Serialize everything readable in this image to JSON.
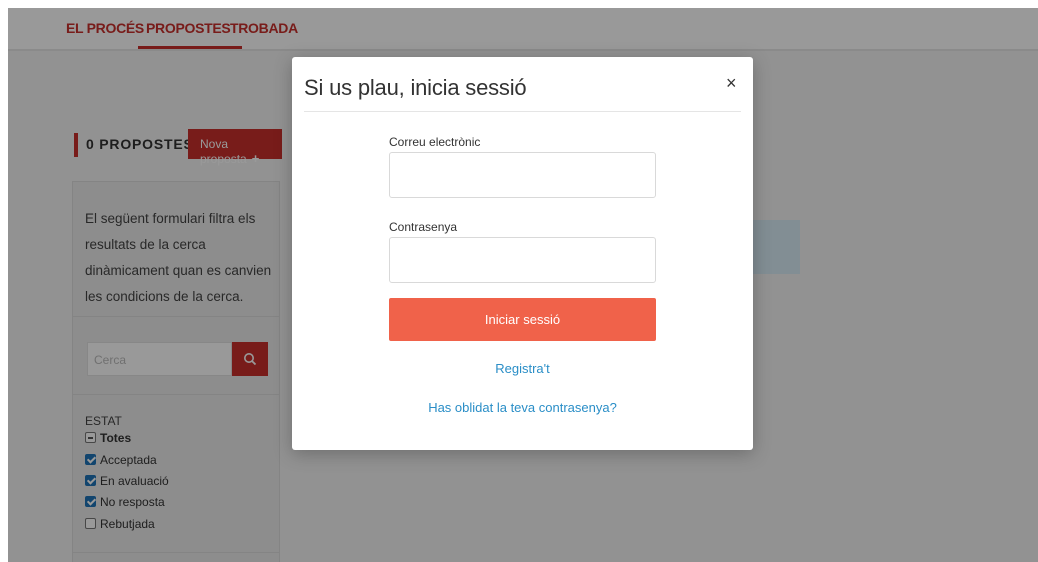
{
  "topnav": {
    "items": [
      {
        "label": "EL PROCÉS"
      },
      {
        "label": "PROPOSTES"
      },
      {
        "label": "TROBADA"
      }
    ]
  },
  "proposals": {
    "heading": "0 PROPOSTES",
    "new_button": "Nova proposta",
    "new_button_icon": "+"
  },
  "filter": {
    "intro": "El següent formulari filtra els resultats de la cerca dinàmicament quan es canvien les condicions de la cerca.",
    "search_placeholder": "Cerca",
    "state_title": "ESTAT",
    "states": [
      {
        "label": "Totes",
        "state": "indeterminate"
      },
      {
        "label": "Acceptada",
        "state": "checked"
      },
      {
        "label": "En avaluació",
        "state": "checked"
      },
      {
        "label": "No resposta",
        "state": "checked"
      },
      {
        "label": "Rebutjada",
        "state": "unchecked"
      }
    ]
  },
  "modal": {
    "title": "Si us plau, inicia sessió",
    "close_label": "×",
    "email_label": "Correu electrònic",
    "email_value": "",
    "password_label": "Contrasenya",
    "password_value": "",
    "submit_label": "Iniciar sessió",
    "register_link": "Registra't",
    "forgot_link": "Has oblidat la teva contrasenya?"
  },
  "colors": {
    "brand_red": "#c9302c",
    "submit_orange": "#f0624a",
    "link_blue": "#2a8ec7",
    "overlay": "rgba(0,0,0,0.4)"
  }
}
